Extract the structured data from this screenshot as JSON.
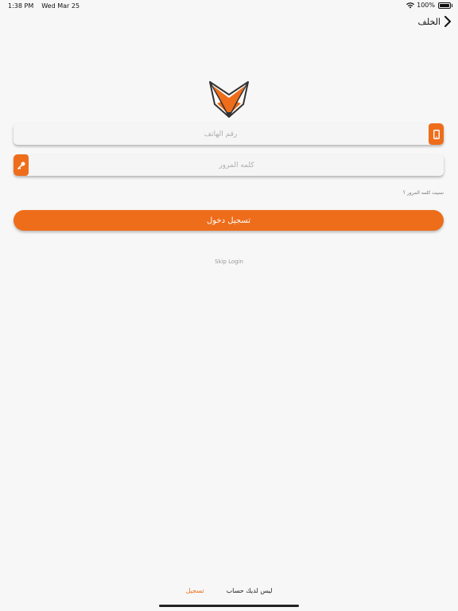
{
  "status_bar": {
    "time": "1:38 PM",
    "date": "Wed Mar 25",
    "battery": "100%",
    "icons": [
      "wifi-icon",
      "battery-icon"
    ]
  },
  "nav": {
    "back_label": "الخلف",
    "back_icon": "chevron-right-icon"
  },
  "logo": {
    "icon": "fox-logo-icon",
    "colors": {
      "primary": "#ee6d1b",
      "outline": "#333333"
    }
  },
  "form": {
    "phone": {
      "placeholder": "رقم الهاتف",
      "value": "",
      "icon": "phone-icon"
    },
    "password": {
      "placeholder": "كلمه المرور",
      "value": "",
      "icon": "key-icon"
    },
    "forgot_password": "نسيت كلمه المرور ؟",
    "login_button": "تسجيل دخول",
    "skip_login": "Skip Login"
  },
  "footer": {
    "no_account": "ليس لديك حساب",
    "register": "تسجيل"
  },
  "colors": {
    "accent": "#ee6d1b",
    "background": "#f7f7f7"
  }
}
